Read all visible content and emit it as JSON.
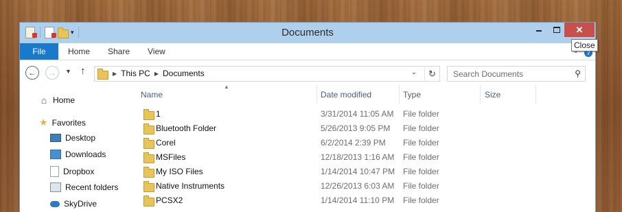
{
  "window": {
    "title": "Documents"
  },
  "title_buttons": {
    "close": "✕"
  },
  "ribbon": {
    "tabs": [
      "File",
      "Home",
      "Share",
      "View"
    ]
  },
  "nav": {
    "crumbs": [
      "This PC",
      "Documents"
    ],
    "search_placeholder": "Search Documents"
  },
  "sidebar": {
    "items": [
      {
        "label": "Home",
        "icon": "home-icon"
      },
      {
        "label": "Favorites",
        "icon": "star-icon"
      },
      {
        "label": "Desktop",
        "icon": "desktop-icon"
      },
      {
        "label": "Downloads",
        "icon": "downloads-icon"
      },
      {
        "label": "Dropbox",
        "icon": "dropbox-icon"
      },
      {
        "label": "Recent folders",
        "icon": "recent-folders-icon"
      },
      {
        "label": "SkyDrive",
        "icon": "skydrive-icon"
      }
    ]
  },
  "columns": {
    "name": "Name",
    "date": "Date modified",
    "type": "Type",
    "size": "Size"
  },
  "files": [
    {
      "name": "1",
      "date": "3/31/2014 11:05 AM",
      "type": "File folder"
    },
    {
      "name": "Bluetooth Folder",
      "date": "5/26/2013 9:05 PM",
      "type": "File folder"
    },
    {
      "name": "Corel",
      "date": "6/2/2014 2:39 PM",
      "type": "File folder"
    },
    {
      "name": "MSFiles",
      "date": "12/18/2013 1:16 AM",
      "type": "File folder"
    },
    {
      "name": "My ISO Files",
      "date": "1/14/2014 10:47 PM",
      "type": "File folder"
    },
    {
      "name": "Native Instruments",
      "date": "12/26/2013 6:03 AM",
      "type": "File folder"
    },
    {
      "name": "PCSX2",
      "date": "1/14/2014 11:10 PM",
      "type": "File folder"
    }
  ],
  "tooltip": "Close",
  "colors": {
    "accent": "#1979ca",
    "titlebar": "#aed0ec",
    "close": "#c7504a",
    "folder": "#e8c45a"
  }
}
